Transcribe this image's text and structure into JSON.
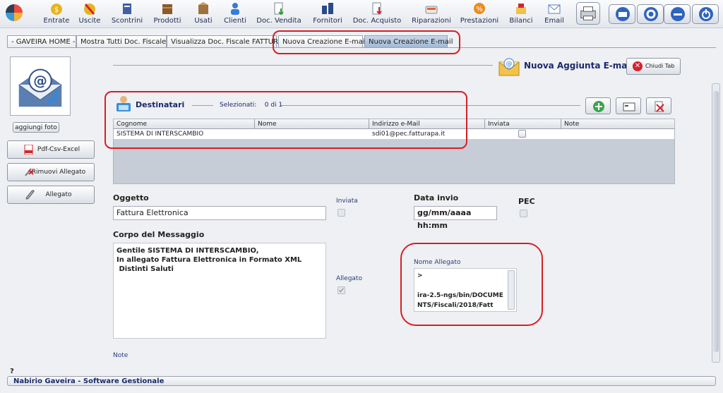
{
  "toolbar": {
    "items": [
      {
        "label": "Entrate",
        "icon": "coin-bag-icon"
      },
      {
        "label": "Uscite",
        "icon": "money-out-icon"
      },
      {
        "label": "Scontrini",
        "icon": "receipt-icon"
      },
      {
        "label": "Prodotti",
        "icon": "products-box-icon"
      },
      {
        "label": "Usati",
        "icon": "used-box-icon"
      },
      {
        "label": "Clienti",
        "icon": "client-icon"
      },
      {
        "label": "Doc. Vendita",
        "icon": "sales-doc-icon"
      },
      {
        "label": "Fornitori",
        "icon": "suppliers-icon"
      },
      {
        "label": "Doc. Acquisto",
        "icon": "purchase-doc-icon"
      },
      {
        "label": "Riparazioni",
        "icon": "repair-icon"
      },
      {
        "label": "Prestazioni",
        "icon": "service-icon"
      },
      {
        "label": "Bilanci",
        "icon": "balance-icon"
      },
      {
        "label": "Email",
        "icon": "email-icon"
      }
    ]
  },
  "tabs": [
    {
      "label": "- GAVEIRA HOME -"
    },
    {
      "label": "Mostra Tutti Doc. Fiscale"
    },
    {
      "label": "Visualizza Doc. Fiscale FATTURA"
    },
    {
      "label": "Nuova Creazione E-mail"
    },
    {
      "label": "Nuova Creazione E-mail"
    }
  ],
  "left": {
    "add_photo": "aggiungi foto",
    "pdf_button": "Pdf-Csv-Excel",
    "remove_attachment": "Rimuovi Allegato",
    "attachment": "Allegato"
  },
  "header": {
    "title": "Nuova Aggiunta E-mail",
    "close_tab": "Chiudi Tab"
  },
  "recipients": {
    "title": "Destinatari",
    "selected_label": "Selezionati:",
    "selected_value": "0 di 1",
    "columns": [
      "Cognome",
      "Nome",
      "Indirizzo e-Mail",
      "Inviata",
      "Note"
    ],
    "rows": [
      {
        "cognome": "SISTEMA DI INTERSCAMBIO",
        "nome": "",
        "email": "sdi01@pec.fatturapa.it",
        "inviata": false,
        "note": ""
      }
    ]
  },
  "form": {
    "subject_label": "Oggetto",
    "subject_value": "Fattura Elettronica",
    "sent_label": "Inviata",
    "send_date_label": "Data invio",
    "send_date_value": "gg/mm/aaaa hh:mm",
    "pec_label": "PEC",
    "body_label": "Corpo del Messaggio",
    "body_value": "Gentile SISTEMA DI INTERSCAMBIO,\nIn allegato Fattura Elettronica in Formato XML\n Distinti Saluti",
    "attached_label": "Allegato",
    "attached_checked": true,
    "attachment_name_label": "Nome Allegato",
    "attachment_name_value": ">\n\nira-2.5-ngs/bin/DOCUMENTS/Fiscali/2018/Fatt",
    "notes_label": "Note"
  },
  "statusbar": {
    "help": "?",
    "text": "Nabirio Gaveira - Software Gestionale"
  },
  "colors": {
    "accent": "#1b2a6b",
    "highlight": "#d61f26"
  }
}
